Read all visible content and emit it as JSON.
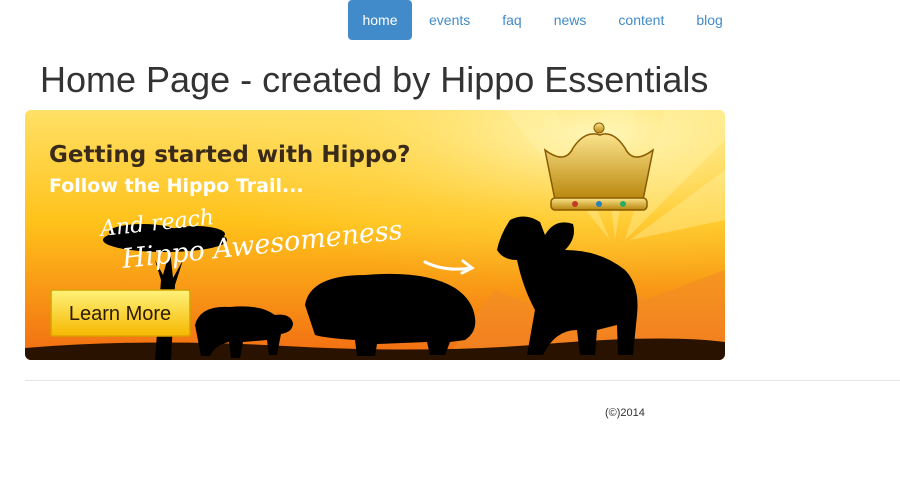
{
  "nav": {
    "items": [
      {
        "label": "home",
        "active": true
      },
      {
        "label": "events",
        "active": false
      },
      {
        "label": "faq",
        "active": false
      },
      {
        "label": "news",
        "active": false
      },
      {
        "label": "content",
        "active": false
      },
      {
        "label": "blog",
        "active": false
      }
    ]
  },
  "page": {
    "title": "Home Page - created by Hippo Essentials"
  },
  "banner": {
    "headline": "Getting started with Hippo?",
    "subheadline": "Follow the Hippo Trail...",
    "handwritten_line1": "And reach",
    "handwritten_line2": "Hippo Awesomeness",
    "button_label": "Learn More"
  },
  "footer": {
    "copyright": "(©)2014"
  },
  "colors": {
    "accent": "#428bca",
    "banner_orange": "#f7941d",
    "banner_yellow": "#ffd200"
  }
}
